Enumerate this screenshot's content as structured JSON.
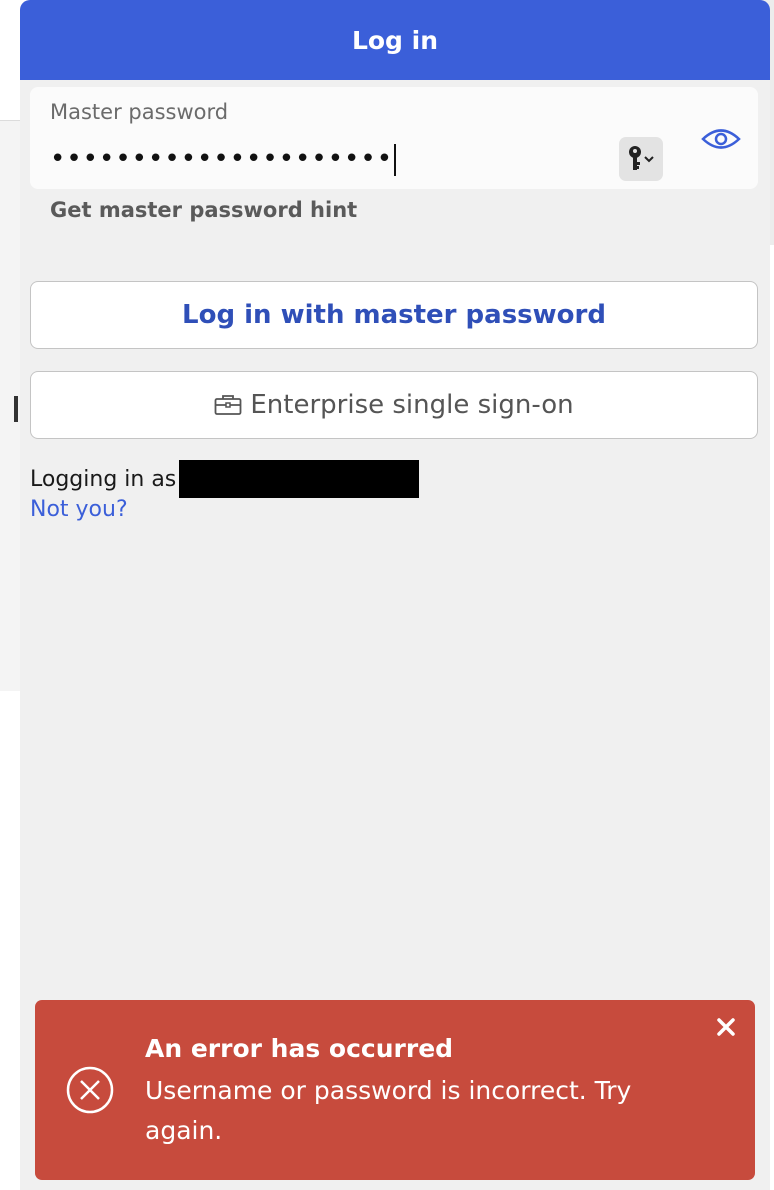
{
  "header": {
    "title": "Log in"
  },
  "password_field": {
    "label": "Master password",
    "masked_value": "•••••••••••••••••••••",
    "key_icon": "key-icon",
    "visibility_icon": "eye-icon"
  },
  "hint_link": "Get master password hint",
  "buttons": {
    "master_login": "Log in with master password",
    "sso": "Enterprise single sign-on",
    "sso_icon": "briefcase-icon"
  },
  "account": {
    "logging_in_as": "Logging in as",
    "not_you": "Not you?"
  },
  "toast": {
    "title": "An error has occurred",
    "message": "Username or password is incorrect. Try again.",
    "icon": "error-circle-x-icon",
    "close_icon": "close-icon"
  },
  "colors": {
    "header": "#3b5fd9",
    "link": "#3b5fd9",
    "toast_bg": "#c74b3d",
    "panel_bg": "#f0f0f0"
  }
}
